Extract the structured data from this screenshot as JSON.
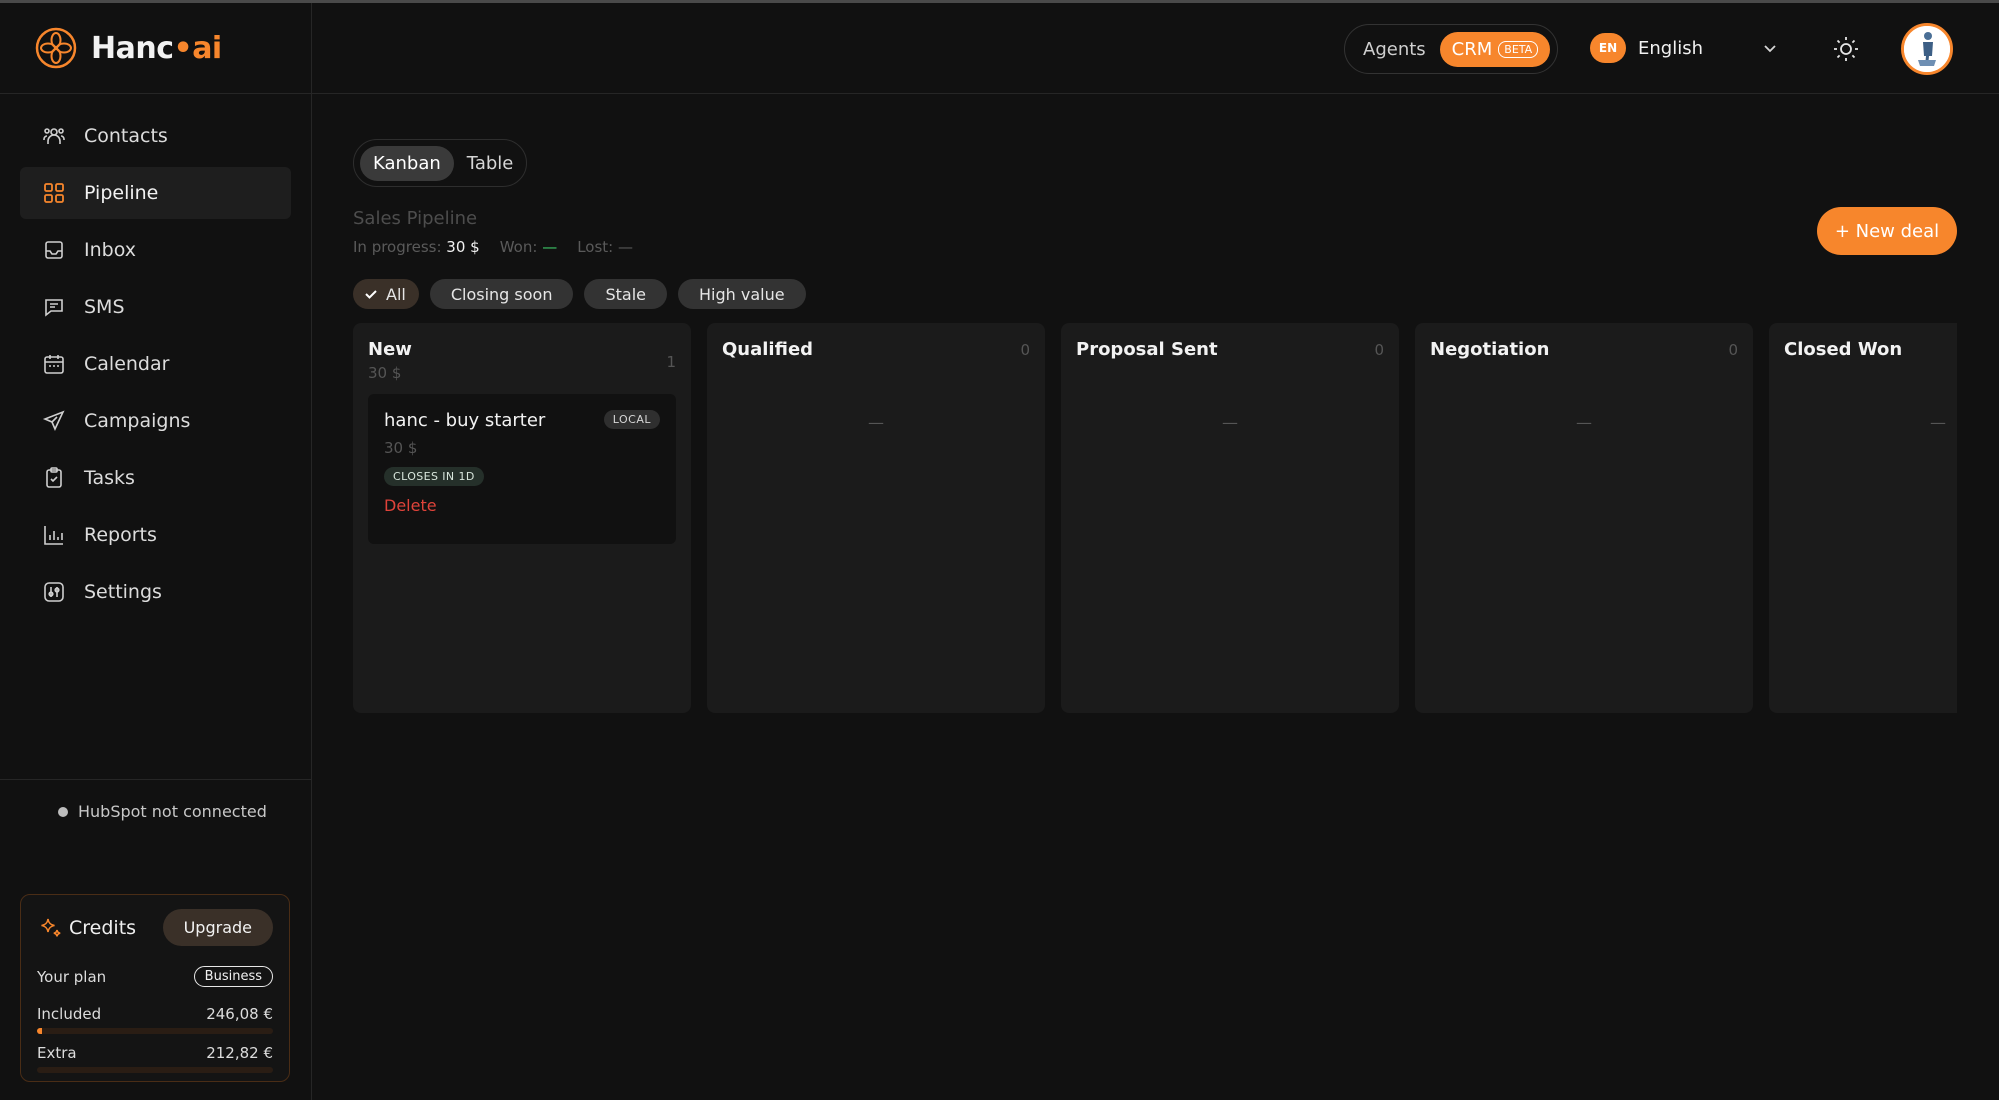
{
  "brand": {
    "name": "Hanc",
    "dot": "•",
    "suffix": "ai",
    "accent": "#f7862c"
  },
  "sidebar": {
    "items": [
      {
        "label": "Contacts",
        "icon": "contacts-icon"
      },
      {
        "label": "Pipeline",
        "icon": "pipeline-icon",
        "active": true
      },
      {
        "label": "Inbox",
        "icon": "inbox-icon"
      },
      {
        "label": "SMS",
        "icon": "sms-icon"
      },
      {
        "label": "Calendar",
        "icon": "calendar-icon"
      },
      {
        "label": "Campaigns",
        "icon": "campaigns-icon"
      },
      {
        "label": "Tasks",
        "icon": "tasks-icon"
      },
      {
        "label": "Reports",
        "icon": "reports-icon"
      },
      {
        "label": "Settings",
        "icon": "settings-icon"
      }
    ],
    "hubspot_status": "HubSpot not connected",
    "credits": {
      "title": "Credits",
      "upgrade_label": "Upgrade",
      "plan_label": "Your plan",
      "plan_name": "Business",
      "included_label": "Included",
      "included_value": "246,08 €",
      "included_fraction": 0.02,
      "extra_label": "Extra",
      "extra_value": "212,82 €",
      "extra_fraction": 0.0
    }
  },
  "topbar": {
    "mode_agents": "Agents",
    "mode_crm": "CRM",
    "mode_beta": "BETA",
    "lang_code": "EN",
    "lang_label": "English"
  },
  "main": {
    "view_tabs": [
      "Kanban",
      "Table"
    ],
    "active_view": "Kanban",
    "pipeline_title": "Sales Pipeline",
    "stats": {
      "in_progress_label": "In progress:",
      "in_progress_value": "30 $",
      "won_label": "Won:",
      "won_value": "—",
      "lost_label": "Lost:",
      "lost_value": "—"
    },
    "new_deal_label": "+ New deal",
    "filters": [
      "All",
      "Closing soon",
      "Stale",
      "High value"
    ],
    "columns": [
      {
        "title": "New",
        "count": "1",
        "sum": "30 $"
      },
      {
        "title": "Qualified",
        "count": "0",
        "empty": "—"
      },
      {
        "title": "Proposal Sent",
        "count": "0",
        "empty": "—"
      },
      {
        "title": "Negotiation",
        "count": "0",
        "empty": "—"
      },
      {
        "title": "Closed Won",
        "count": "",
        "empty": "—"
      }
    ],
    "deal": {
      "name": "hanc - buy starter",
      "badge": "LOCAL",
      "amount": "30 $",
      "tag": "CLOSES IN 1D",
      "delete_label": "Delete"
    }
  }
}
